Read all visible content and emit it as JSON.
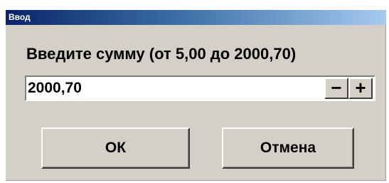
{
  "window": {
    "title": "Ввод"
  },
  "dialog": {
    "prompt": "Введите сумму (от 5,00 до 2000,70)",
    "amount_value": "2000,70",
    "decrement_label": "−",
    "increment_label": "+",
    "ok_label": "ОК",
    "cancel_label": "Отмена"
  }
}
